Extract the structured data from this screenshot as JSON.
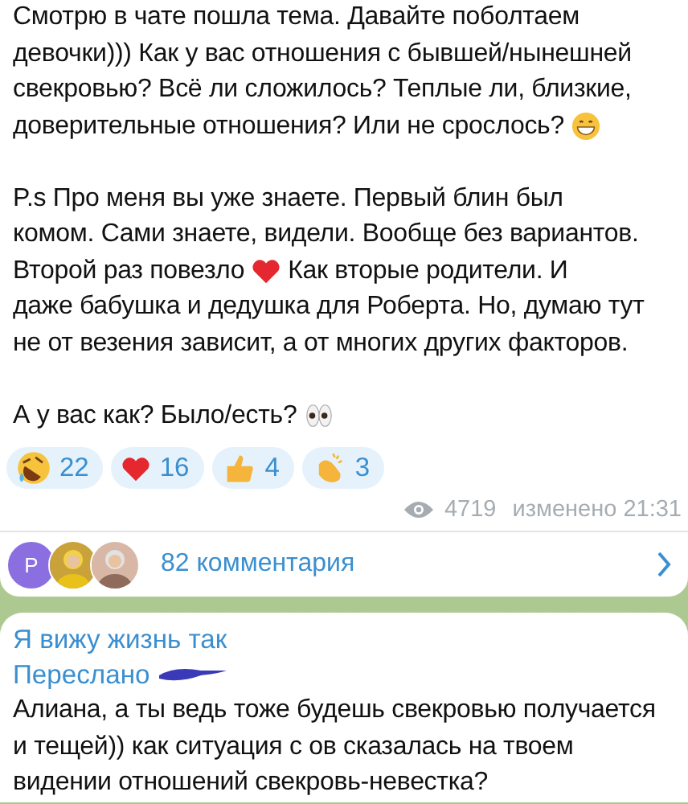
{
  "post": {
    "paragraphs": [
      {
        "blocks": [
          [
            {
              "kind": "text",
              "text": "Смотрю в чате пошла тема. Давайте поболтаем девочки))) Как у вас отношения с бывшей/нынешней свекровью? Всё ли сложилось? Теплые ли, близкие,"
            }
          ],
          [
            {
              "kind": "text",
              "text": "доверительные отношения? Или не срослось?"
            },
            {
              "kind": "grin"
            }
          ]
        ]
      },
      {
        "blocks": [
          [
            {
              "kind": "text",
              "text": "P.s Про меня вы уже знаете. Первый блин был"
            }
          ],
          [
            {
              "kind": "text",
              "text": "комом. Сами знаете, видели. Вообще без вариантов."
            }
          ],
          [
            {
              "kind": "text",
              "text": "Второй раз повезло"
            },
            {
              "kind": "heart"
            },
            {
              "kind": "text",
              "text": "Как вторые родители. И"
            }
          ],
          [
            {
              "kind": "text",
              "text": "даже бабушка и дедушка для Роберта. Но, думаю тут не от везения зависит, а от многих других факторов."
            }
          ]
        ]
      },
      {
        "blocks": [
          [
            {
              "kind": "text",
              "text": "А у вас как? Было/есть?"
            },
            {
              "kind": "eyes"
            }
          ]
        ]
      }
    ],
    "reactions": [
      {
        "kind": "rofl",
        "count": "22"
      },
      {
        "kind": "heart",
        "count": "16"
      },
      {
        "kind": "thumbs_up",
        "count": "4"
      },
      {
        "kind": "clap",
        "count": "3"
      }
    ],
    "views": "4719",
    "edited_time": "изменено 21:31",
    "comments": {
      "avatars": [
        {
          "kind": "letter",
          "letter": "Р",
          "color": "#8b6fe0"
        },
        {
          "kind": "picture"
        },
        {
          "kind": "picture"
        }
      ],
      "label": "82 комментария"
    }
  },
  "next_message": {
    "author": "Я вижу жизнь так",
    "forwarded": "Переслано",
    "text": "Алиана, а ты ведь тоже будешь свекровью получается и тещей)) как ситуация с ов сказалась на твоем видении отношений свекровь-невестка?"
  }
}
